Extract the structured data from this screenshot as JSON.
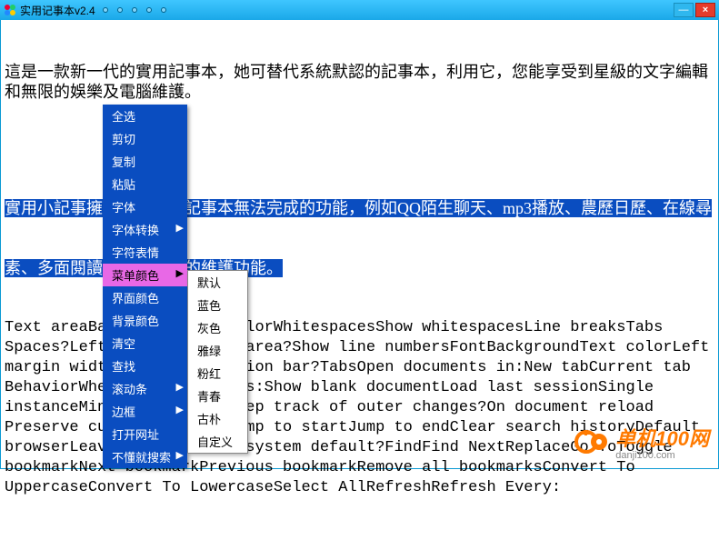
{
  "window": {
    "title": "实用记事本v2.4",
    "min": "—",
    "close": "×"
  },
  "paragraph_intro": "這是一款新一代的實用記事本，她可替代系統默認的記事本，利用它，您能享受到星級的文字編輯和無限的娛樂及電腦維護。",
  "paragraph_selected": "實用小記事擁有許多系統記事本無法完成的功能，例如QQ陌生聊天、mp3播放、農歷日歷、在線尋",
  "paragraph_selected_tail": "素、多面閱讀及各種電腦的維護功能。",
  "body_lines": [
    "Text areaBackgroundText colorWhitespacesShow whitespacesLine breaksTabs",
    "Spaces?Left marginas area area?Show line numbersFontBackgroundText colorLeft",
    "margin width?CurrentSelection bar?TabsOpen documents in:New tabCurrent tab",
    "BehaviorWhen_program_starts:Show blank documentLoad last sessionSingle",
    "instanceMinimize to trayKeep track of outer changes?On document reload",
    "Preserve cursor positionJump to startJump to endClear search historyDefault",
    "browserLeave blank to use system default?FindFind NextReplaceGo ToToggle",
    "bookmarkNext bookmarkPrevious bookmarkRemove all bookmarksConvert To",
    "UppercaseConvert To LowercaseSelect AllRefreshRefresh Every:"
  ],
  "context_menu": {
    "items": [
      {
        "label": "全选",
        "arrow": false
      },
      {
        "label": "剪切",
        "arrow": false
      },
      {
        "label": "复制",
        "arrow": false
      },
      {
        "label": "粘贴",
        "arrow": false
      },
      {
        "label": "字体",
        "arrow": false
      },
      {
        "label": "字体转换",
        "arrow": true
      },
      {
        "label": "字符表情",
        "arrow": false
      },
      {
        "label": "菜单颜色",
        "arrow": true,
        "hover": true
      },
      {
        "label": "界面颜色",
        "arrow": false
      },
      {
        "label": "背景颜色",
        "arrow": false
      },
      {
        "label": "清空",
        "arrow": false
      },
      {
        "label": "查找",
        "arrow": false
      },
      {
        "label": "滚动条",
        "arrow": true
      },
      {
        "label": "边框",
        "arrow": true
      },
      {
        "label": "打开网址",
        "arrow": false
      },
      {
        "label": "不懂就搜索",
        "arrow": true
      }
    ]
  },
  "submenu": {
    "items": [
      "默认",
      "蓝色",
      "灰色",
      "雅绿",
      "粉红",
      "青春",
      "古朴",
      "自定义"
    ]
  },
  "watermark": {
    "brand": "单机100网",
    "url": "danji100.com"
  }
}
